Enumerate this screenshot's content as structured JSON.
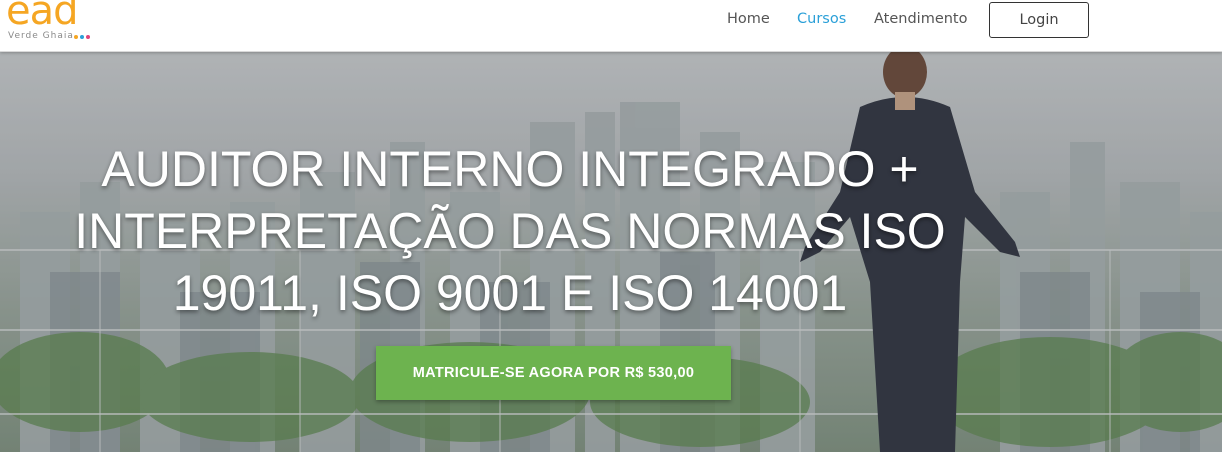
{
  "brand": {
    "logo_text": "ead",
    "logo_subtext": "Verde Ghaia",
    "logo_color": "#f5a623",
    "dot_colors": [
      "#f5a623",
      "#2ba0d8",
      "#e0457b"
    ]
  },
  "nav": {
    "items": [
      {
        "label": "Home"
      },
      {
        "label": "Cursos",
        "active": true
      },
      {
        "label": "Atendimento"
      }
    ],
    "login_label": "Login",
    "active_color": "#2ba0d8"
  },
  "hero": {
    "title": "AUDITOR INTERNO INTEGRADO + INTERPRETAÇÃO DAS NORMAS ISO 19011, ISO 9001 E ISO 14001",
    "cta_label": "MATRICULE-SE AGORA POR R$ 530,00",
    "cta_color": "#6db34f"
  }
}
